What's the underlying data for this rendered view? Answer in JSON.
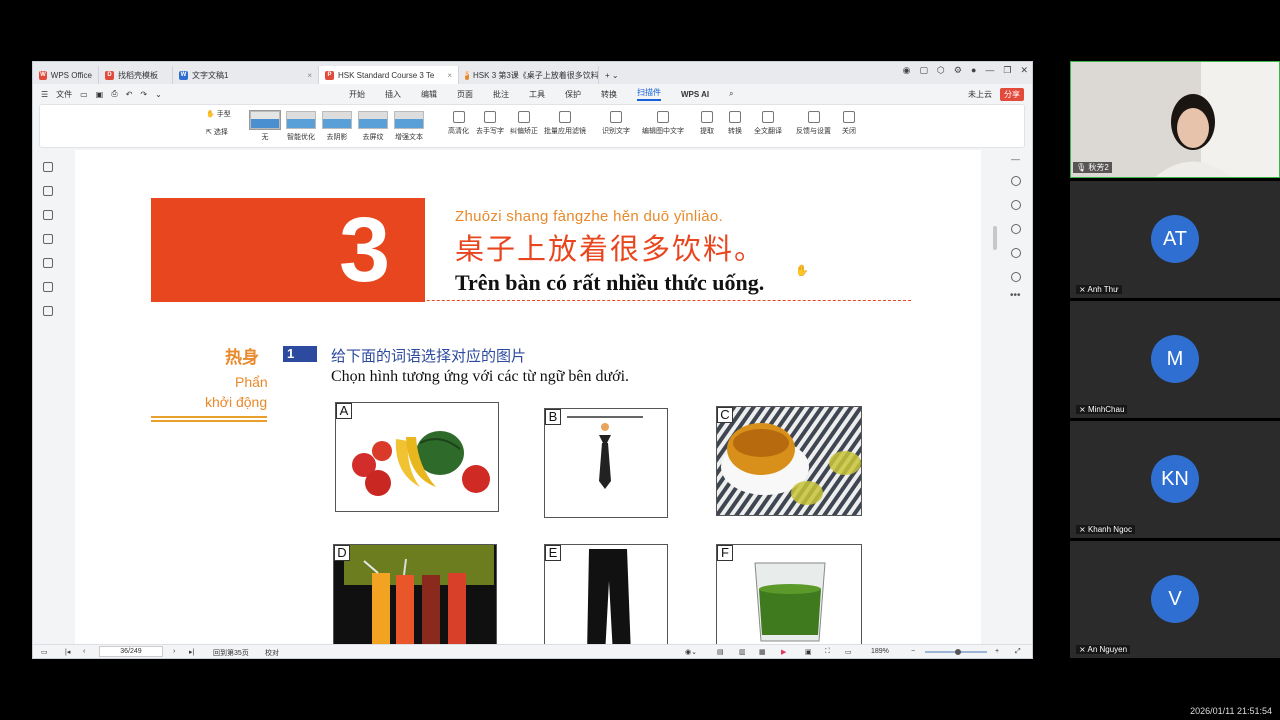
{
  "wps": {
    "tabs": [
      {
        "label": "WPS Office",
        "icon_color": "#e24a3b",
        "icon": "W"
      },
      {
        "label": "找稻壳模板",
        "icon_color": "#e24a3b",
        "icon": "D"
      },
      {
        "label": "文字文稿1",
        "icon_color": "#2f6fd1",
        "icon": "W"
      },
      {
        "label": "HSK Standard Course 3 Te",
        "icon_color": "#e24a3b",
        "icon": "P"
      },
      {
        "label": "HSK 3 第3课《桌子上放着很多饮料",
        "icon_color": "#e8892b",
        "icon": "P"
      }
    ],
    "menu_left": [
      "文件"
    ],
    "menu_center": [
      "开始",
      "插入",
      "编辑",
      "页面",
      "批注",
      "工具",
      "保护",
      "转换",
      "扫描件",
      "WPS AI"
    ],
    "menu_active": "扫描件",
    "menu_right": {
      "cloud": "未上云",
      "share": "分享"
    },
    "ribbon": {
      "hand": "手型",
      "select": "选择",
      "thumbs": [
        "无",
        "智能优化",
        "去阴影",
        "去屏纹",
        "增强文本"
      ],
      "tools": [
        "高清化",
        "去手写字",
        "纠偏矫正",
        "批量应用滤镜",
        "识别文字",
        "编辑图中文字",
        "提取",
        "转换",
        "全文翻译",
        "反馈与设置",
        "关闭"
      ]
    },
    "status": {
      "page": "36/249",
      "goto": "回到第35页",
      "proof": "校对",
      "zoom": "189%"
    }
  },
  "doc": {
    "lesson_number": "3",
    "pinyin": "Zhuōzi  shang fàngzhe  hěn  duō   yǐnliào.",
    "hanzi": "桌子上放着很多饮料。",
    "viet_title": "Trên bàn có rất nhiều thức uống.",
    "warmup_cn": "热身",
    "warmup_vi_1": "Phẩn",
    "warmup_vi_2": "khởi động",
    "exercise_number": "1",
    "instr_cn": "给下面的词语选择对应的图片",
    "instr_vi": "Chọn hình tương ứng với các từ ngữ bên dưới.",
    "pictures": [
      "A",
      "B",
      "C",
      "D",
      "E",
      "F"
    ]
  },
  "participants": [
    {
      "name": "秋芳2",
      "initials": ""
    },
    {
      "name": "Anh Thư",
      "initials": "AT"
    },
    {
      "name": "MinhChau",
      "initials": "M"
    },
    {
      "name": "Khanh Ngoc",
      "initials": "KN"
    },
    {
      "name": "An Nguyen",
      "initials": "V"
    }
  ],
  "clock": "2026/01/11 21:51:54",
  "colors": {
    "accent": "#1560d6",
    "lesson_red": "#e8461e",
    "avatar_blue": "#2f6fd1"
  }
}
